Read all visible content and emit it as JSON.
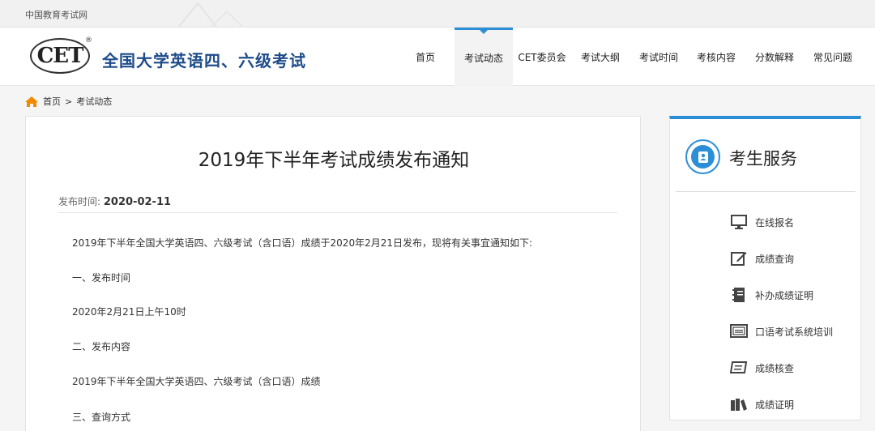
{
  "topbar": {
    "site_name": "中国教育考试网"
  },
  "header": {
    "logo": "CET",
    "logo_reg": "®",
    "title": "全国大学英语四、六级考试"
  },
  "nav": {
    "items": [
      {
        "label": "首页"
      },
      {
        "label": "考试动态"
      },
      {
        "label": "CET委员会"
      },
      {
        "label": "考试大纲"
      },
      {
        "label": "考试时间"
      },
      {
        "label": "考核内容"
      },
      {
        "label": "分数解释"
      },
      {
        "label": "常见问题"
      }
    ],
    "active_index": 1
  },
  "breadcrumb": {
    "home": "首页",
    "separator": ">",
    "current": "考试动态"
  },
  "article": {
    "title": "2019年下半年考试成绩发布通知",
    "meta_label": "发布时间:",
    "meta_date": "2020-02-11",
    "paragraphs": [
      "2019年下半年全国大学英语四、六级考试（含口语）成绩于2020年2月21日发布，现将有关事宜通知如下:",
      "一、发布时间",
      "2020年2月21日上午10时",
      "二、发布内容",
      "2019年下半年全国大学英语四、六级考试（含口语）成绩",
      "三、查询方式"
    ]
  },
  "side": {
    "title": "考生服务",
    "items": [
      {
        "label": "在线报名",
        "icon": "monitor-icon"
      },
      {
        "label": "成绩查询",
        "icon": "edit-icon"
      },
      {
        "label": "补办成绩证明",
        "icon": "notebook-icon"
      },
      {
        "label": "口语考试系统培训",
        "icon": "screen-icon"
      },
      {
        "label": "成绩核查",
        "icon": "book-open-icon"
      },
      {
        "label": "成绩证明",
        "icon": "books-icon"
      }
    ]
  },
  "colors": {
    "accent": "#2c8fd6",
    "title_blue": "#1e4c8a",
    "home_orange": "#f08a00"
  }
}
